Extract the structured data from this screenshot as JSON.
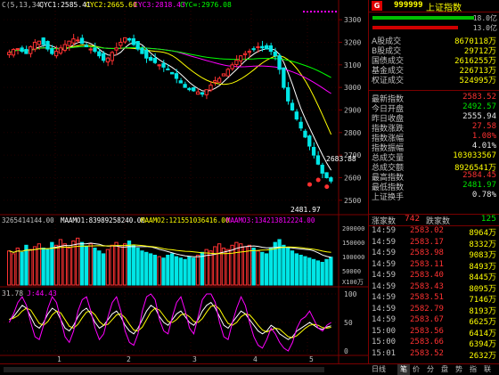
{
  "top_legend": {
    "prefix": "C(5,13,34)",
    "cyc1": "CYC1:2585.41",
    "cyc2": "CYC2:2665.60",
    "cyc3": "CYC3:2818.43",
    "cyc4": "CYC∞:2976.08"
  },
  "vol_legend": {
    "a": "3265414144.00",
    "b": "MAAMO1:83989258240.00",
    "c": "MAAMO2:121551036416.00",
    "d": "MAAMO3:134213812224.00"
  },
  "osc_legend": {
    "a": "31.78",
    "b": "J:44.43"
  },
  "price_axis": [
    "3300",
    "3200",
    "3100",
    "3000",
    "2900",
    "2800",
    "2700",
    "2600",
    "2500"
  ],
  "vol_axis": [
    "200000",
    "150000",
    "100000",
    "50000",
    "X100万"
  ],
  "osc_axis": [
    "100",
    "50",
    "0"
  ],
  "annotations": {
    "high": "2683.88",
    "low": "2481.97"
  },
  "month_labels": [
    "1",
    "2",
    "3",
    "4",
    "5"
  ],
  "header": {
    "code": "999999",
    "name": "上证指数",
    "badge": "G",
    "bar1": "18.0亿",
    "bar2": "13.0亿"
  },
  "quotes1": [
    {
      "label": "A股成交",
      "value": "8670118万",
      "color": "yel"
    },
    {
      "label": "B股成交",
      "value": "29712万",
      "color": "yel"
    },
    {
      "label": "国债成交",
      "value": "2616255万",
      "color": "yel"
    },
    {
      "label": "基金成交",
      "value": "226713万",
      "color": "yel"
    },
    {
      "label": "权证成交",
      "value": "524995万",
      "color": "yel"
    }
  ],
  "quotes2": [
    {
      "label": "最新指数",
      "value": "2583.52",
      "color": "red"
    },
    {
      "label": "今日开盘",
      "value": "2492.57",
      "color": "grn"
    },
    {
      "label": "昨日收盘",
      "value": "2555.94",
      "color": "wht"
    },
    {
      "label": "指数涨跌",
      "value": "27.58",
      "color": "red"
    },
    {
      "label": "指数涨幅",
      "value": "1.08%",
      "color": "red"
    },
    {
      "label": "指数振幅",
      "value": "4.01%",
      "color": "wht"
    },
    {
      "label": "总成交量",
      "value": "103033567",
      "color": "yel"
    },
    {
      "label": "总成交额",
      "value": "8926541万",
      "color": "yel"
    },
    {
      "label": "最高指数",
      "value": "2584.45",
      "color": "red"
    },
    {
      "label": "最低指数",
      "value": "2481.97",
      "color": "grn"
    },
    {
      "label": "上证换手",
      "value": "0.78%",
      "color": "wht"
    }
  ],
  "breadth": {
    "up_label": "涨家数",
    "up": "742",
    "down_label": "跌家数",
    "down": "125"
  },
  "trades": [
    {
      "t": "14:59",
      "p": "2583.02",
      "v": "8964万"
    },
    {
      "t": "14:59",
      "p": "2583.17",
      "v": "8332万"
    },
    {
      "t": "14:59",
      "p": "2583.98",
      "v": "9083万"
    },
    {
      "t": "14:59",
      "p": "2583.11",
      "v": "8493万"
    },
    {
      "t": "14:59",
      "p": "2583.40",
      "v": "8445万"
    },
    {
      "t": "14:59",
      "p": "2583.43",
      "v": "8095万"
    },
    {
      "t": "14:59",
      "p": "2583.51",
      "v": "7146万"
    },
    {
      "t": "14:59",
      "p": "2582.79",
      "v": "8193万"
    },
    {
      "t": "14:59",
      "p": "2583.67",
      "v": "6625万"
    },
    {
      "t": "15:00",
      "p": "2583.56",
      "v": "6414万"
    },
    {
      "t": "15:00",
      "p": "2583.66",
      "v": "6394万"
    },
    {
      "t": "15:01",
      "p": "2583.52",
      "v": "2632万"
    }
  ],
  "bottom_tabs": [
    "日线",
    "笔",
    "价",
    "分",
    "盘",
    "势",
    "指",
    "联"
  ],
  "close_ma": [
    3155,
    3168,
    3172,
    3160,
    3150,
    3180,
    3200,
    3205,
    3190,
    3170,
    3150,
    3160,
    3175,
    3190,
    3205,
    3215,
    3210,
    3195,
    3180,
    3170,
    3160,
    3140,
    3120,
    3130,
    3155,
    3175,
    3200,
    3220,
    3210,
    3190,
    3170,
    3150,
    3130,
    3120,
    3110,
    3100,
    3090,
    3080,
    3060,
    3040,
    3020,
    3000,
    2990,
    2985,
    2980,
    2970,
    2990,
    3010,
    3030,
    3040,
    3060,
    3080,
    3100,
    3120,
    3140,
    3150,
    3160,
    3170,
    3180,
    3175,
    3170,
    3160,
    3140,
    3080,
    3000,
    2940,
    2900,
    2860,
    2820,
    2780,
    2740,
    2700,
    2660,
    2620,
    2600,
    2585
  ],
  "volumes": [
    120000,
    110000,
    130000,
    115000,
    140000,
    125000,
    135000,
    145000,
    130000,
    125000,
    150000,
    140000,
    160000,
    145000,
    130000,
    155000,
    165000,
    150000,
    135000,
    145000,
    130000,
    120000,
    110000,
    125000,
    140000,
    150000,
    135000,
    145000,
    155000,
    140000,
    130000,
    120000,
    115000,
    110000,
    105000,
    100000,
    95000,
    105000,
    110000,
    100000,
    95000,
    90000,
    100000,
    95000,
    105000,
    115000,
    125000,
    120000,
    135000,
    145000,
    130000,
    125000,
    140000,
    150000,
    145000,
    135000,
    140000,
    130000,
    120000,
    115000,
    110000,
    130000,
    150000,
    160000,
    140000,
    130000,
    120000,
    110000,
    105000,
    100000,
    95000,
    90000,
    85000,
    80000,
    90000,
    98000
  ],
  "osc_k": [
    55,
    60,
    70,
    80,
    75,
    60,
    45,
    40,
    50,
    65,
    75,
    70,
    55,
    40,
    35,
    45,
    60,
    70,
    75,
    65,
    50,
    40,
    45,
    55,
    65,
    70,
    60,
    45,
    35,
    30,
    40,
    55,
    70,
    80,
    75,
    60,
    50,
    45,
    55,
    65,
    70,
    60,
    50,
    45,
    55,
    70,
    80,
    85,
    75,
    60,
    45,
    40,
    50,
    60,
    70,
    65,
    55,
    45,
    35,
    30,
    35,
    45,
    40,
    30,
    25,
    20,
    25,
    35,
    40,
    45,
    50,
    45,
    40,
    38,
    42,
    44
  ],
  "osc_j": [
    50,
    65,
    85,
    95,
    80,
    50,
    25,
    20,
    45,
    75,
    95,
    85,
    55,
    25,
    15,
    35,
    70,
    90,
    95,
    70,
    40,
    20,
    30,
    60,
    85,
    95,
    70,
    35,
    15,
    10,
    30,
    70,
    95,
    100,
    90,
    55,
    35,
    30,
    60,
    85,
    95,
    70,
    40,
    30,
    60,
    90,
    100,
    100,
    85,
    50,
    25,
    20,
    50,
    75,
    95,
    80,
    50,
    25,
    10,
    5,
    20,
    40,
    30,
    15,
    5,
    0,
    15,
    40,
    55,
    60,
    70,
    55,
    40,
    35,
    45,
    50
  ]
}
